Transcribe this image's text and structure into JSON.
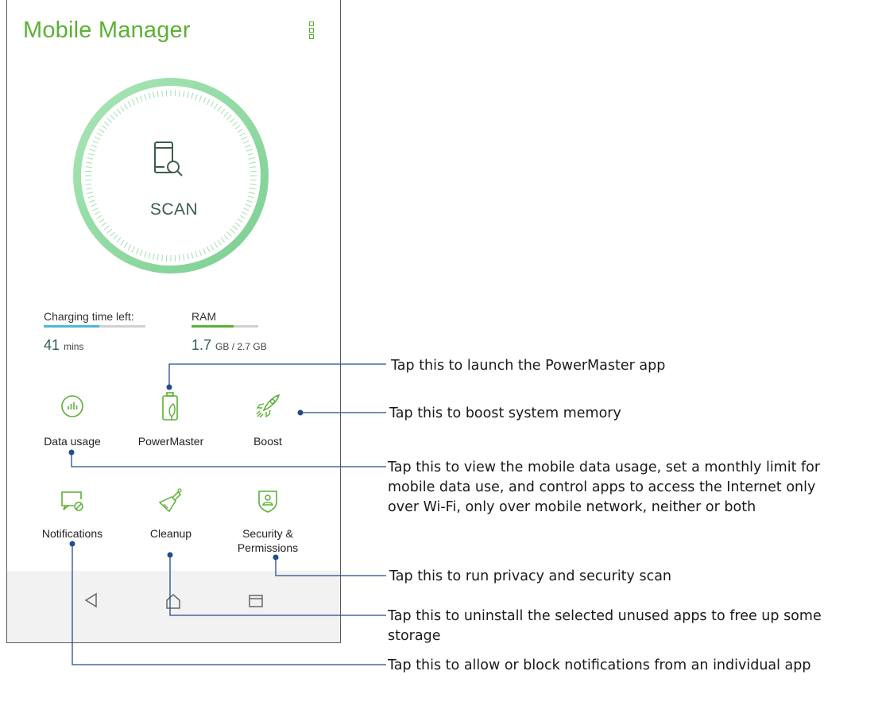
{
  "app": {
    "title": "Mobile Manager",
    "accent_color": "#5cb035",
    "ring_color": "#8fd8a0"
  },
  "scan": {
    "label": "SCAN"
  },
  "stats": {
    "charging": {
      "label": "Charging time left:",
      "value": "41",
      "unit": "mins",
      "bar_color": "#4fb7d9",
      "level": 0.55
    },
    "ram": {
      "label": "RAM",
      "value": "1.7",
      "unit": "GB / 2.7 GB",
      "bar_color": "#5cb035",
      "level": 0.63
    }
  },
  "features": {
    "data_usage": {
      "label": "Data usage",
      "icon": "data-usage-icon"
    },
    "powermaster": {
      "label": "PowerMaster",
      "icon": "battery-leaf-icon"
    },
    "boost": {
      "label": "Boost",
      "icon": "rocket-icon"
    },
    "notifications": {
      "label": "Notifications",
      "icon": "notification-block-icon"
    },
    "cleanup": {
      "label": "Cleanup",
      "icon": "broom-icon"
    },
    "security": {
      "label_line1": "Security &",
      "label_line2": "Permissions",
      "icon": "shield-user-icon"
    }
  },
  "navbar": {
    "back": "back-icon",
    "home": "home-icon",
    "recents": "recents-icon"
  },
  "callouts": {
    "powermaster": "Tap this to launch the PowerMaster app",
    "boost": "Tap this to boost system memory",
    "data_usage_1": "Tap this to view the mobile data usage, set a monthly limit for",
    "data_usage_2": "mobile data use, and control apps to access the Internet only",
    "data_usage_3": "over Wi-Fi, only over mobile network, neither or both",
    "security": "Tap this  to run privacy and security scan",
    "cleanup_1": "Tap this to uninstall the selected unused apps to free up some",
    "cleanup_2": "storage",
    "notifications": "Tap this to allow or block notifications from an individual app"
  }
}
